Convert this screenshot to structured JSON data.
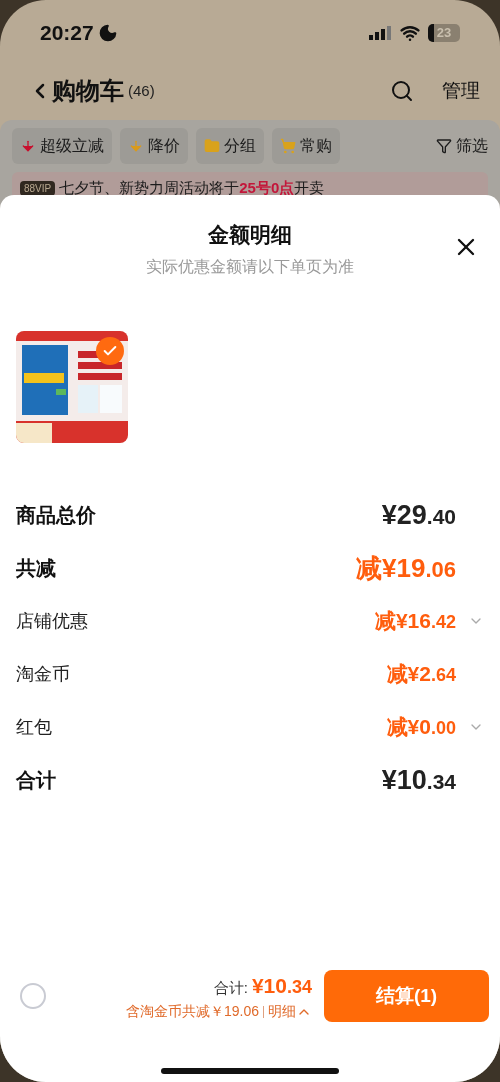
{
  "status_bar": {
    "time": "20:27",
    "battery": "23"
  },
  "header": {
    "title": "购物车",
    "count": "(46)",
    "action": "管理"
  },
  "chips": [
    {
      "label": "超级立减",
      "color": "#c8102e"
    },
    {
      "label": "降价",
      "color": "#d99a1c"
    },
    {
      "label": "分组",
      "color": "#d9a21c"
    },
    {
      "label": "常购",
      "color": "#d9a21c"
    }
  ],
  "filter": {
    "label": "筛选"
  },
  "notice": {
    "badge": "88VIP",
    "text": "七夕节、新势力周活动将于**25号0点**开卖"
  },
  "sheet": {
    "title": "金额明细",
    "subtitle": "实际优惠金额请以下单页为准",
    "products": [
      {
        "kind": "picture",
        "checked": true
      }
    ],
    "rows": [
      {
        "kind": "total",
        "label": "商品总价",
        "value": "¥29.40"
      },
      {
        "kind": "discount",
        "label": "共减",
        "value": "减¥19.06"
      },
      {
        "kind": "item",
        "label": "店铺优惠",
        "value": "减¥16.42",
        "expandable": true
      },
      {
        "kind": "item",
        "label": "淘金币",
        "value": "减¥2.64",
        "expandable": false
      },
      {
        "kind": "item",
        "label": "红包",
        "value": "减¥0.00",
        "expandable": true
      },
      {
        "kind": "total",
        "label": "合计",
        "value": "¥10.34"
      }
    ]
  },
  "footer": {
    "select_all_checked": false,
    "total_label": "合计:",
    "total": "¥10.34",
    "saving": "含淘金币共减￥19.06",
    "detail": "明细",
    "checkout": "结算(1)"
  }
}
